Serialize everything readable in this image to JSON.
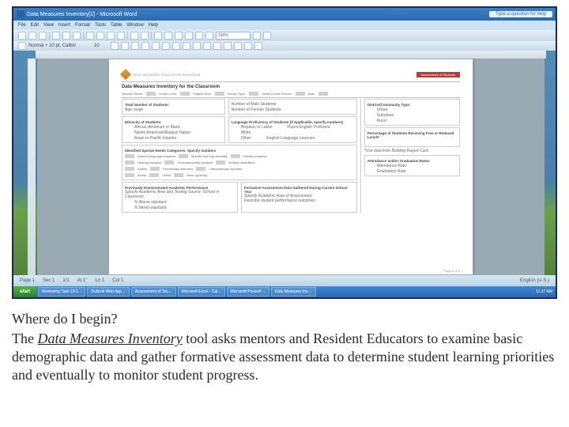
{
  "window": {
    "title": "Data Measures Inventory[1] - Microsoft Word",
    "help_button": "Type a question for help"
  },
  "menu": [
    "File",
    "Edit",
    "View",
    "Insert",
    "Format",
    "Tools",
    "Table",
    "Window",
    "Help"
  ],
  "toolbar": {
    "zoom": "100%",
    "style": "Normal + 10 pt, Calibri",
    "font_size": "10"
  },
  "doc": {
    "brand": "OHIO RESIDENT EDUCATOR PROGRAM",
    "badge": "Assessment of Students",
    "title": "Data Measures Inventory for the Classroom",
    "top_row": {
      "teacher": "Teacher Name:",
      "grade": "Grade Level:",
      "subject": "Subject Area:",
      "schooltype": "School Type:",
      "levels": "Grade Levels Served:",
      "date": "Date:"
    },
    "left_a_title": "Total Number of Students:",
    "age_range": "Age range:",
    "mid_a": {
      "male": "Number of Male Students:",
      "female": "Number of Female Students:",
      "lang": "Language Proficiency of Students (if Applicable, specify numbers)",
      "fluent": "Fluent English Proficient",
      "ell": "English Language Learners"
    },
    "right_a_title": "District/Community Type:",
    "right_a_items": [
      "Urban",
      "Suburban",
      "Rural"
    ],
    "eth_title": "Ethnicity of Students:",
    "eth_items": [
      "African-American or Black",
      "Native American/Alaskan Native",
      "Asian or Pacific Islander",
      "Hispanic or Latino",
      "White",
      "Other:"
    ],
    "right_b_title": "Percentage of Students Receiving Free or Reduced Lunch*",
    "right_b_note": "*Use data from Building Report Card",
    "spec_title": "Identified Special Needs Categories: Specify numbers",
    "spec_items": [
      "Speech/language-impaired",
      "Specific learning disability",
      "Visually impaired",
      "Hearing impaired",
      "Developmentally delayed",
      "Multiple disabilities",
      "Autism",
      "Emotionally disturbed",
      "Orthopedically impaired",
      "At-risk",
      "Gifted",
      "Other (specify):"
    ],
    "right_c_title": "Attendance and/or Graduation Rates:",
    "right_c_items": [
      "Attendance Rate",
      "Graduation Rate"
    ],
    "prev_title": "Previously Demonstrated Academic Performance",
    "prev_sub": "Specify Academic Area and Testing Source: School or Classroom",
    "prev_items": [
      "% Above standard",
      "% Meets standard"
    ],
    "form_title_r": "Formative Assessment Data Gathered During Current School Year",
    "form_sub_r1": "Specify Academic Area of Assessment:",
    "form_sub_r2": "Describe student performance outcomes:",
    "pagenum": "Page 6 of 9"
  },
  "status": {
    "page": "Page 1",
    "sec": "Sec 1",
    "pages": "1/1",
    "at": "At 1\"",
    "ln": "Ln 1",
    "col": "Col 1",
    "lang": "English (U.S.)"
  },
  "taskbar": {
    "start": "start",
    "items": [
      "Reviewing Task 10-1…",
      "Outlook Web App…",
      "Assessment of Stu…",
      "Microsoft Excel - Cal…",
      "Microsoft PowerP…",
      "Data Measures Inv…"
    ],
    "clock": "11:27 AM"
  },
  "caption": {
    "q": "Where do I begin?",
    "p1a": "The ",
    "p1b": "Data Measures Inventory",
    "p1c": " tool asks mentors and Resident Educators to examine basic demographic data and gather formative assessment data to determine student learning priorities and eventually to monitor student progress."
  }
}
